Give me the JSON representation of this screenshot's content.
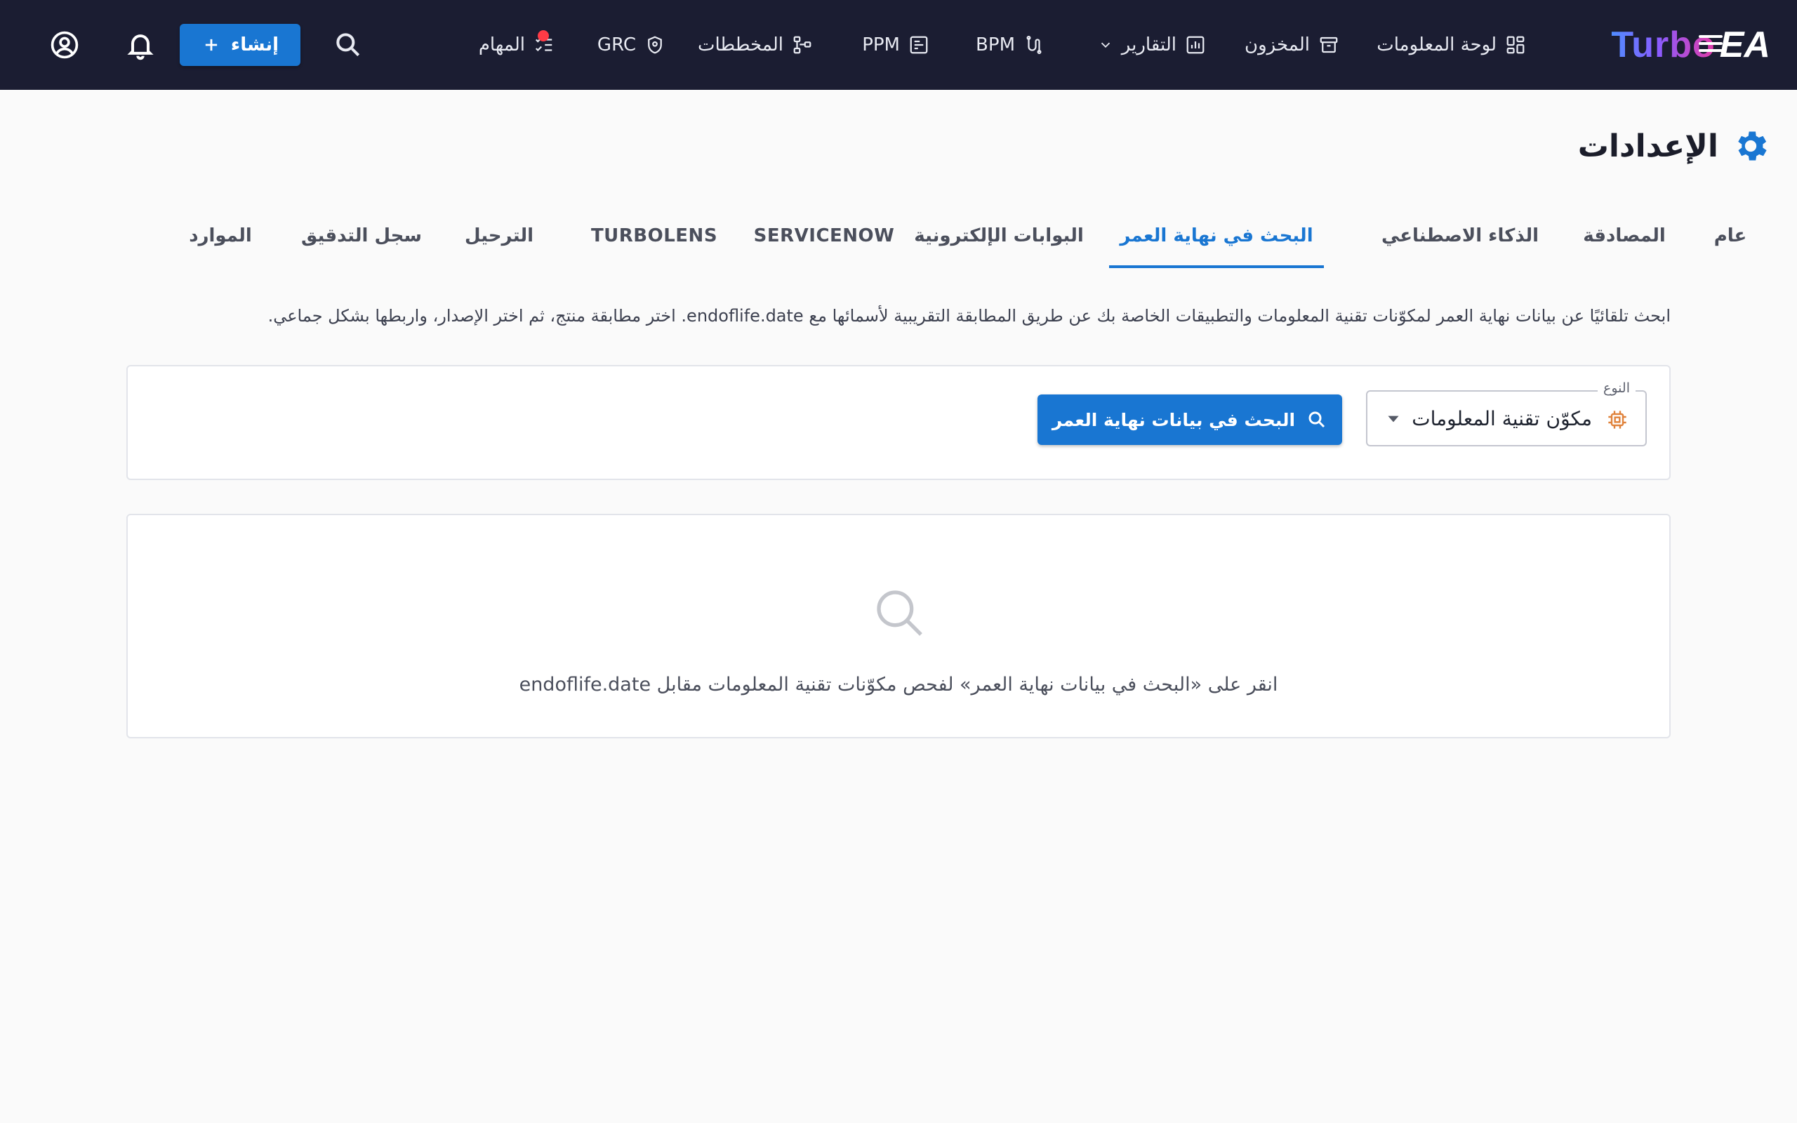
{
  "app": {
    "logo_main": "Turbo",
    "logo_suffix": "EA"
  },
  "nav": {
    "items": [
      {
        "label": "لوحة المعلومات",
        "icon": "dashboard-icon"
      },
      {
        "label": "المخزون",
        "icon": "archive-icon"
      },
      {
        "label": "التقارير",
        "icon": "bar-chart-icon",
        "has_dropdown": true
      },
      {
        "label": "BPM",
        "icon": "flow-icon"
      },
      {
        "label": "PPM",
        "icon": "project-icon"
      },
      {
        "label": "المخططات",
        "icon": "diagram-icon"
      },
      {
        "label": "GRC",
        "icon": "shield-icon"
      },
      {
        "label": "المهام",
        "icon": "checklist-icon",
        "has_badge": true
      }
    ],
    "create_label": "إنشاء"
  },
  "colors": {
    "topbar": "#1b1d32",
    "primary": "#1976d2",
    "badge": "#ff3b46",
    "chip_icon": "#e0823b"
  },
  "page": {
    "title": "الإعدادات"
  },
  "tabs": [
    {
      "label": "عام",
      "active": false
    },
    {
      "label": "المصادقة",
      "active": false
    },
    {
      "label": "الذكاء الاصطناعي",
      "active": false
    },
    {
      "label": "البحث في نهاية العمر",
      "active": true
    },
    {
      "label": "البوابات الإلكترونية",
      "active": false
    },
    {
      "label": "SERVICENOW",
      "active": false
    },
    {
      "label": "TURBOLENS",
      "active": false
    },
    {
      "label": "الترحيل",
      "active": false
    },
    {
      "label": "سجل التدقيق",
      "active": false
    },
    {
      "label": "الموارد",
      "active": false
    }
  ],
  "eol": {
    "description": "ابحث تلقائيًا عن بيانات نهاية العمر لمكوّنات تقنية المعلومات والتطبيقات الخاصة بك عن طريق المطابقة التقريبية لأسمائها مع endoflife.date. اختر مطابقة منتج، ثم اختر الإصدار، واربطها بشكل جماعي.",
    "type_label": "النوع",
    "type_value": "مكوّن تقنية المعلومات",
    "search_button": "البحث في بيانات نهاية العمر",
    "empty_text": "انقر على «البحث في بيانات نهاية العمر» لفحص مكوّنات تقنية المعلومات مقابل endoflife.date"
  }
}
